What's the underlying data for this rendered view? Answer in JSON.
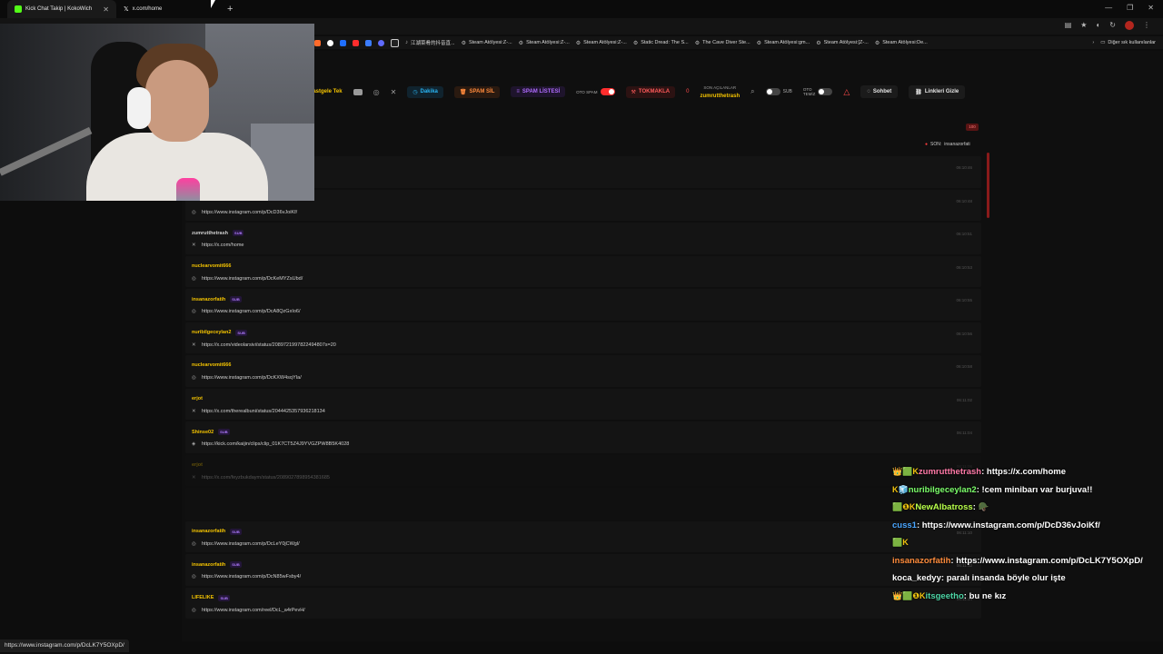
{
  "browser": {
    "tabs": [
      {
        "title": "Kick Chat Takip | KokoWich",
        "active": true
      },
      {
        "title": "x.com/home",
        "active": false
      }
    ],
    "bookmarks": [
      {
        "label": "江湖菜肴的抖音直...",
        "color": "#ffffff"
      },
      {
        "label": "Steam Atölyesi:Z-...",
        "color": "#ffffff"
      },
      {
        "label": "Steam Atölyesi:Z-...",
        "color": "#ffffff"
      },
      {
        "label": "Steam Atölyesi:Z-...",
        "color": "#ffffff"
      },
      {
        "label": "Static Dread: The S...",
        "color": "#ffffff"
      },
      {
        "label": "The Cave Diver Ste...",
        "color": "#ffffff"
      },
      {
        "label": "Steam Atölyesi:gm...",
        "color": "#ffffff"
      },
      {
        "label": "Steam Atölyesi:[Z-...",
        "color": "#ffffff"
      },
      {
        "label": "Steam Atölyesi:De...",
        "color": "#ffffff"
      }
    ],
    "bookmark_folder": "Diğer sık kullanılanlar",
    "status_url": "https://www.instagram.com/p/DcLK7Y5OXpD/"
  },
  "toolbar": {
    "random_label": "Rastgele Tek",
    "timer_label": "Dakika",
    "spam_delete_label": "SPAM SİL",
    "spam_list_label": "SPAM LİSTESİ",
    "auto_spam_label_1": "OTO",
    "auto_spam_label_2": "SPAM",
    "tokmakla_label": "TOKMAKLA",
    "tokmakla_count": "0",
    "last_opened_label": "SON AÇILANLAR",
    "last_opened_user": "zumrutthetrash",
    "sub_label": "SUB",
    "auto_clear_label_1": "OTO",
    "auto_clear_label_2": "TEMİZ",
    "chat_label": "Sohbet",
    "hide_links_label": "Linkleri Gizle"
  },
  "counter_badge": "100",
  "last_user": {
    "prefix": "SON:",
    "name": "insanazorfati"
  },
  "feed": [
    {
      "user": "",
      "color": "#cfcfcf",
      "sub": false,
      "icon": "",
      "link": "",
      "time": "06:10:46",
      "dim": false
    },
    {
      "user": "cuss1",
      "color": "#f5c400",
      "sub": false,
      "icon": "instagram-icon",
      "link": "https://www.instagram.com/p/DcD36vJoiKf/",
      "time": "06:10:48",
      "dim": false
    },
    {
      "user": "zumrutthetrash",
      "color": "#cfcfcf",
      "sub": true,
      "icon": "x-icon",
      "link": "https://x.com/home",
      "time": "06:10:51",
      "dim": false
    },
    {
      "user": "nuclearvomit666",
      "color": "#f5c400",
      "sub": false,
      "icon": "instagram-icon",
      "link": "https://www.instagram.com/p/DcKeMYZsUbd/",
      "time": "06:10:53",
      "dim": false
    },
    {
      "user": "insanazorfatih",
      "color": "#f5c400",
      "sub": true,
      "icon": "instagram-icon",
      "link": "https://www.instagram.com/p/DcA8QzGxIo6/",
      "time": "06:10:55",
      "dim": false
    },
    {
      "user": "nuribilgeceylan2",
      "color": "#f5c400",
      "sub": true,
      "icon": "x-icon",
      "link": "https://x.com/videolarsivi/status/2089721997822494807s=20",
      "time": "06:10:56",
      "dim": false
    },
    {
      "user": "nuclearvomit666",
      "color": "#f5c400",
      "sub": false,
      "icon": "instagram-icon",
      "link": "https://www.instagram.com/p/DcKXW4sqYIa/",
      "time": "06:10:58",
      "dim": false
    },
    {
      "user": "erjot",
      "color": "#f5c400",
      "sub": false,
      "icon": "x-icon",
      "link": "https://x.com/therealbuni/status/2044425357936218134",
      "time": "06:11:02",
      "dim": false
    },
    {
      "user": "Shinse02",
      "color": "#f5c400",
      "sub": true,
      "icon": "kick-icon",
      "link": "https://kick.com/kaijin/clips/clip_01K7CT5Z4J9YVGZPW8B5K4028",
      "time": "06:11:04",
      "dim": false
    },
    {
      "user": "erjot",
      "color": "#f5c400",
      "sub": false,
      "icon": "x-icon",
      "link": "https://x.com/feyzbukdaym/status/2089027898954381685",
      "time": "06:11:06",
      "dim": true
    },
    {
      "user": "",
      "color": "#cfcfcf",
      "sub": false,
      "icon": "",
      "link": "",
      "time": "",
      "dim": true
    },
    {
      "user": "insanazorfatih",
      "color": "#f5c400",
      "sub": true,
      "icon": "instagram-icon",
      "link": "https://www.instagram.com/p/DcLeY0jCWgl/",
      "time": "06:11:10",
      "dim": false
    },
    {
      "user": "insanazorfatih",
      "color": "#f5c400",
      "sub": true,
      "icon": "instagram-icon",
      "link": "https://www.instagram.com/p/DcN85wFsby4/",
      "time": "06:11:12",
      "dim": false
    },
    {
      "user": "LIFELIKE",
      "color": "#f5c400",
      "sub": true,
      "icon": "instagram-icon",
      "link": "https://www.instagram.com/reel/DcL_a4rPevH/",
      "time": "06:11:14",
      "dim": false
    }
  ],
  "overlay_chat": [
    {
      "badges": "👑🟩K",
      "user": "zumrutthetrash",
      "ucolor": "#ff7aa8",
      "text": "https://x.com/home"
    },
    {
      "badges": "K🧊",
      "user": "nuribilgeceylan2",
      "ucolor": "#7bff6a",
      "text": "!cem minibarı var burjuva!!"
    },
    {
      "badges": "🟩❶K",
      "user": "NewAlbatross",
      "ucolor": "#b8ff4a",
      "text": "🪖"
    },
    {
      "badges": "",
      "user": "cuss1",
      "ucolor": "#4aa6ff",
      "text": "https://www.instagram.com/p/DcD36vJoiKf/"
    },
    {
      "badges": "🟩K",
      "user": "",
      "ucolor": "#ffffff",
      "text": ""
    },
    {
      "badges": "",
      "user": "insanazorfatih",
      "ucolor": "#ff8c3c",
      "text": "https://www.instagram.com/p/DcLK7Y5OXpD/"
    },
    {
      "badges": "",
      "user": "koca_kedyy",
      "ucolor": "#ffffff",
      "text": "paralı insanda böyle olur işte"
    },
    {
      "badges": "👑🟩❶K",
      "user": "itsgeetho",
      "ucolor": "#4dd6a6",
      "text": "bu ne kız"
    }
  ]
}
